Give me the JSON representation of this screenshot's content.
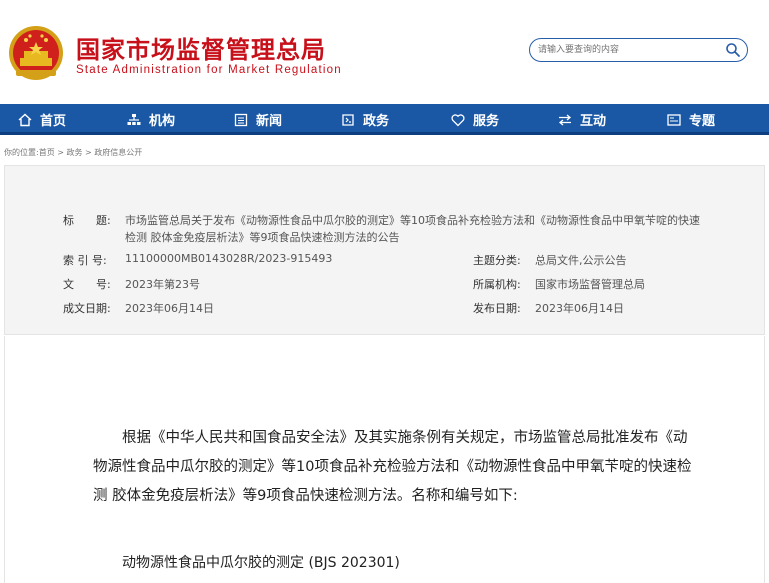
{
  "header": {
    "title_cn": "国家市场监督管理总局",
    "title_en": "State Administration for Market Regulation",
    "search_placeholder": "请输入要查询的内容"
  },
  "nav": [
    {
      "label": "首页",
      "icon": "home-icon"
    },
    {
      "label": "机构",
      "icon": "org-icon"
    },
    {
      "label": "新闻",
      "icon": "news-icon"
    },
    {
      "label": "政务",
      "icon": "gov-icon"
    },
    {
      "label": "服务",
      "icon": "service-icon"
    },
    {
      "label": "互动",
      "icon": "interact-icon"
    },
    {
      "label": "专题",
      "icon": "topic-icon"
    }
  ],
  "breadcrumb": {
    "prefix": "你的位置:",
    "items": [
      "首页",
      "政务",
      "政府信息公开"
    ],
    "sep": " > "
  },
  "meta": {
    "title_label": "标　　题:",
    "title_value": "市场监管总局关于发布《动物源性食品中瓜尔胶的测定》等10项食品补充检验方法和《动物源性食品中甲氧苄啶的快速检测 胶体金免疫层析法》等9项食品快速检测方法的公告",
    "index_label": "索 引 号:",
    "index_value": "11100000MB0143028R/2023-915493",
    "doc_label": "文　　号:",
    "doc_value": "2023年第23号",
    "created_label": "成文日期:",
    "created_value": "2023年06月14日",
    "category_label": "主题分类:",
    "category_value": "总局文件,公示公告",
    "org_label": "所属机构:",
    "org_value": "国家市场监督管理总局",
    "published_label": "发布日期:",
    "published_value": "2023年06月14日"
  },
  "body": {
    "paragraph": "根据《中华人民共和国食品安全法》及其实施条例有关规定，市场监管总局批准发布《动物源性食品中瓜尔胶的测定》等10项食品补充检验方法和《动物源性食品中甲氧苄啶的快速检测 胶体金免疫层析法》等9项食品快速检测方法。名称和编号如下:",
    "item1": "动物源性食品中瓜尔胶的测定 (BJS 202301)"
  },
  "colors": {
    "brand_red": "#c8101a",
    "nav_blue": "#1a58a6"
  }
}
